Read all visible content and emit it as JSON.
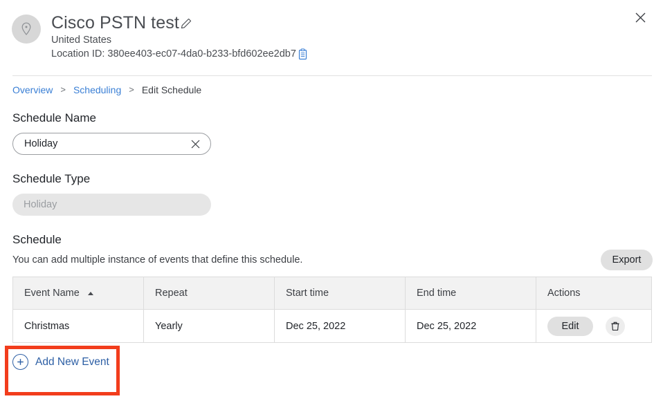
{
  "header": {
    "location_icon": "map-pin-icon",
    "title": "Cisco PSTN test",
    "edit_icon": "pencil-icon",
    "country": "United States",
    "location_id_label": "Location ID: 380ee403-ec07-4da0-b233-bfd602ee2db7",
    "copy_icon": "clipboard-copy-icon",
    "close_icon": "close-icon"
  },
  "breadcrumb": {
    "items": [
      {
        "label": "Overview",
        "link": true
      },
      {
        "label": "Scheduling",
        "link": true
      },
      {
        "label": "Edit Schedule",
        "link": false
      }
    ],
    "separator": ">"
  },
  "form": {
    "schedule_name": {
      "label": "Schedule Name",
      "value": "Holiday",
      "clear_icon": "close-icon"
    },
    "schedule_type": {
      "label": "Schedule Type",
      "value": "Holiday",
      "disabled": true
    }
  },
  "schedule_section": {
    "heading": "Schedule",
    "description": "You can add multiple instance of events that define this schedule.",
    "export_label": "Export"
  },
  "table": {
    "columns": [
      {
        "label": "Event Name",
        "sorted": "asc",
        "sort_icon": "sort-ascending-icon"
      },
      {
        "label": "Repeat"
      },
      {
        "label": "Start time"
      },
      {
        "label": "End time"
      },
      {
        "label": "Actions"
      }
    ],
    "rows": [
      {
        "event_name": "Christmas",
        "repeat": "Yearly",
        "start_time": "Dec 25, 2022",
        "end_time": "Dec 25, 2022",
        "edit_label": "Edit",
        "delete_icon": "trash-icon"
      }
    ]
  },
  "add_event": {
    "label": "Add New Event",
    "icon": "plus-circle-icon",
    "highlighted": true
  },
  "colors": {
    "link": "#3a7fd5",
    "action_link": "#2d5fa5",
    "annotation": "#f23d1c",
    "button_grey": "#e0e0e0",
    "table_header": "#f2f2f2",
    "border": "#dcdcdc",
    "disabled_bg": "#e6e6e6"
  }
}
